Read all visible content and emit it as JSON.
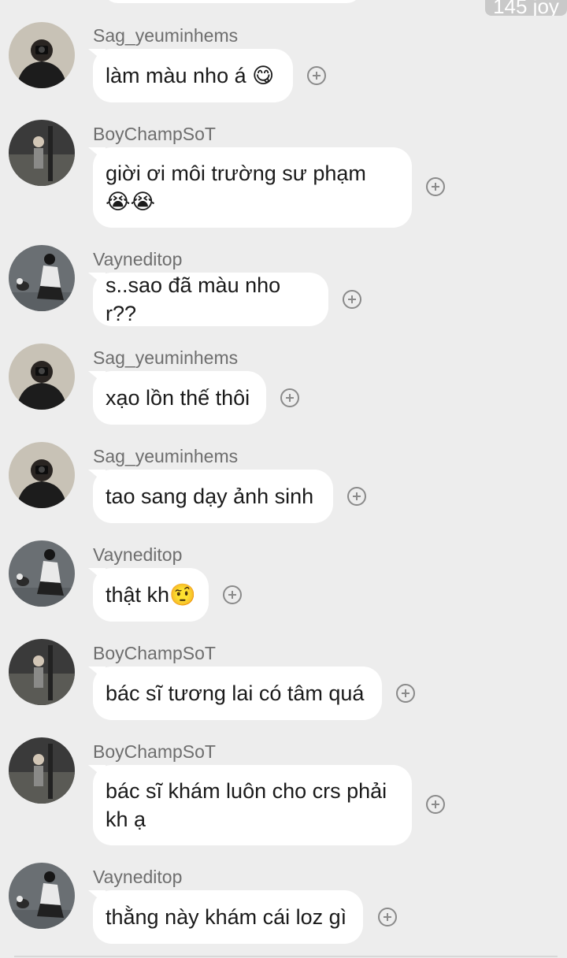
{
  "top_badge": "145 joy",
  "messages": [
    {
      "sender": "Sag_yeuminhems",
      "text": "làm màu nho á 😋",
      "avatar": "sag"
    },
    {
      "sender": "BoyChampSoT",
      "text": "giời ơi môi trường sư phạm\n😭😭",
      "avatar": "boy"
    },
    {
      "sender": "Vayneditop",
      "text": "s..sao đã màu nho r??",
      "avatar": "vayne"
    },
    {
      "sender": "Sag_yeuminhems",
      "text": "xạo lồn thế thôi",
      "avatar": "sag"
    },
    {
      "sender": "Sag_yeuminhems",
      "text": "tao sang dạy ảnh sinh",
      "avatar": "sag"
    },
    {
      "sender": "Vayneditop",
      "text": "thật kh🤨",
      "avatar": "vayne"
    },
    {
      "sender": "BoyChampSoT",
      "text": "bác sĩ tương lai có tâm quá",
      "avatar": "boy"
    },
    {
      "sender": "BoyChampSoT",
      "text": "bác sĩ khám luôn cho crs phải\nkh ạ",
      "avatar": "boy"
    },
    {
      "sender": "Vayneditop",
      "text": "thằng này khám cái loz gì",
      "avatar": "vayne"
    }
  ],
  "icons": {
    "add_reaction": "plus-circle-icon"
  }
}
